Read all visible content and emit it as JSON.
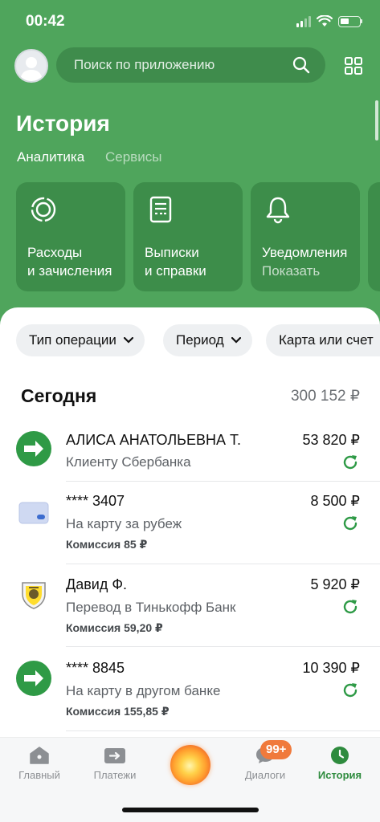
{
  "status_bar": {
    "time": "00:42"
  },
  "header": {
    "search_placeholder": "Поиск по приложению",
    "title": "История",
    "tabs": [
      {
        "label": "Аналитика",
        "active": true
      },
      {
        "label": "Сервисы",
        "active": false
      }
    ]
  },
  "tiles": [
    {
      "line1": "Расходы",
      "line2": "и зачисления",
      "icon": "donut-chart-icon"
    },
    {
      "line1": "Выписки",
      "line2": "и справки",
      "icon": "document-icon"
    },
    {
      "line1": "Уведомления",
      "line2": "Показать",
      "icon": "bell-icon"
    }
  ],
  "filters": [
    {
      "label": "Тип операции"
    },
    {
      "label": "Период"
    },
    {
      "label": "Карта или счет"
    }
  ],
  "day_group": {
    "label": "Сегодня",
    "total": "300 152 ₽"
  },
  "transactions": [
    {
      "name": "АЛИСА АНАТОЛЬЕВНА Т.",
      "subtitle": "Клиенту Сбербанка",
      "fee": "",
      "amount": "53 820 ₽",
      "icon": "transfer-arrow-icon"
    },
    {
      "name": "**** 3407",
      "subtitle": "На карту за рубеж",
      "fee": "Комиссия 85 ₽",
      "amount": "8 500 ₽",
      "icon": "bank-card-icon"
    },
    {
      "name": "Давид Ф.",
      "subtitle": "Перевод в Тинькофф Банк",
      "fee": "Комиссия 59,20 ₽",
      "amount": "5 920 ₽",
      "icon": "tinkoff-logo-icon"
    },
    {
      "name": "**** 8845",
      "subtitle": "На карту в другом банке",
      "fee": "Комиссия 155,85 ₽",
      "amount": "10 390 ₽",
      "icon": "transfer-arrow-icon"
    }
  ],
  "tabbar": {
    "items": [
      {
        "label": "Главный",
        "icon": "home-icon"
      },
      {
        "label": "Платежи",
        "icon": "payments-icon"
      },
      {
        "label": "",
        "icon": "assistant-orb-icon"
      },
      {
        "label": "Диалоги",
        "icon": "chat-icon",
        "badge": "99+"
      },
      {
        "label": "История",
        "icon": "clock-icon",
        "active": true
      }
    ]
  },
  "colors": {
    "brand_green": "#4fa55c",
    "tile_green": "#3d8d4a",
    "accent_green": "#2e8b3e",
    "badge_orange": "#f07a3c"
  }
}
